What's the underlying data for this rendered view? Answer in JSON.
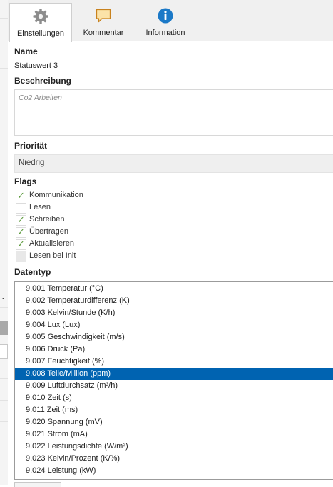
{
  "tabs": [
    {
      "label": "Einstellungen",
      "icon": "gear-icon",
      "active": true
    },
    {
      "label": "Kommentar",
      "icon": "comment-icon",
      "active": false
    },
    {
      "label": "Information",
      "icon": "info-icon",
      "active": false
    }
  ],
  "form": {
    "name_label": "Name",
    "name_value": "Statuswert 3",
    "description_label": "Beschreibung",
    "description_placeholder": "Co2 Arbeiten",
    "priority_label": "Priorität",
    "priority_value": "Niedrig",
    "flags_label": "Flags",
    "flags": [
      {
        "label": "Kommunikation",
        "checked": true,
        "enabled": true
      },
      {
        "label": "Lesen",
        "checked": false,
        "enabled": true
      },
      {
        "label": "Schreiben",
        "checked": true,
        "enabled": true
      },
      {
        "label": "Übertragen",
        "checked": true,
        "enabled": true
      },
      {
        "label": "Aktualisieren",
        "checked": true,
        "enabled": true
      },
      {
        "label": "Lesen bei Init",
        "checked": false,
        "enabled": false
      }
    ],
    "datatype_label": "Datentyp",
    "datatypes": [
      "9.001 Temperatur (°C)",
      "9.002 Temperaturdifferenz (K)",
      "9.003 Kelvin/Stunde (K/h)",
      "9.004 Lux (Lux)",
      "9.005 Geschwindigkeit (m/s)",
      "9.006 Druck (Pa)",
      "9.007 Feuchtigkeit (%)",
      "9.008 Teile/Million (ppm)",
      "9.009 Luftdurchsatz (m³/h)",
      "9.010 Zeit (s)",
      "9.011 Zeit (ms)",
      "9.020 Spannung (mV)",
      "9.021 Strom (mA)",
      "9.022 Leistungsdichte (W/m²)",
      "9.023 Kelvin/Prozent (K/%)",
      "9.024 Leistung (kW)"
    ],
    "selected_datatype": "9.008 Teile/Million (ppm)"
  },
  "colors": {
    "selection": "#0063b1",
    "check": "#5c9a3c",
    "info_icon": "#1b79c7",
    "comment_icon": "#f0b84a"
  }
}
